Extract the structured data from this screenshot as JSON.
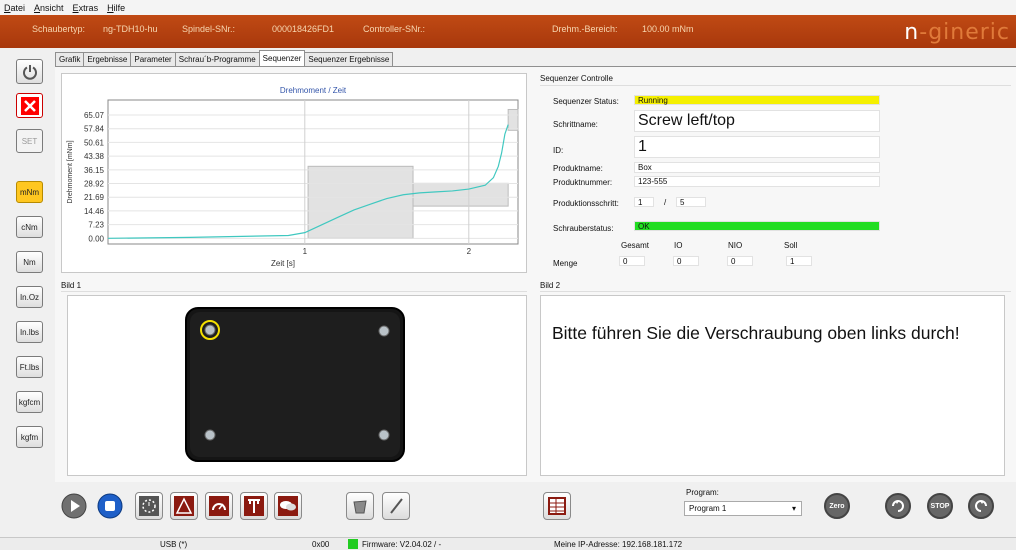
{
  "menu": {
    "items": [
      "Datei",
      "Ansicht",
      "Extras",
      "Hilfe"
    ]
  },
  "header": {
    "schraubertyp_label": "Schaubertyp:",
    "schraubertyp_value": "ng-TDH10-hu",
    "spindel_label": "Spindel-SNr.:",
    "spindel_value": "000018426FD1",
    "controller_label": "Controller-SNr.:",
    "controller_value": "",
    "range_label": "Drehm.-Bereich:",
    "range_value": "100.00 mNm",
    "brand_logo": "n-gineric"
  },
  "sidebar": {
    "power_icon": "power-icon",
    "close_icon": "close-icon",
    "set_label": "SET",
    "units": [
      "mNm",
      "cNm",
      "Nm",
      "In.Oz",
      "In.lbs",
      "Ft.lbs",
      "kgfcm",
      "kgfm"
    ],
    "active_unit": "mNm"
  },
  "tabs": [
    "Grafik",
    "Ergebnisse",
    "Parameter",
    "Schrau´b-Programme",
    "Sequenzer",
    "Sequenzer Ergebnisse"
  ],
  "selected_tab": "Sequenzer",
  "chart_panel": {
    "chart_data": {
      "type": "line",
      "title": "Drehmoment / Zeit",
      "xlabel": "Zeit [s]",
      "ylabel": "Drehmoment [mNm]",
      "yticks": [
        "65.07",
        "57.84",
        "50.61",
        "43.38",
        "36.15",
        "28.92",
        "21.69",
        "14.46",
        "7.23",
        "0.00"
      ],
      "xticks": [
        "1",
        "2"
      ],
      "xlim": [
        -0.2,
        2.3
      ],
      "ylim": [
        -3,
        73
      ],
      "grid": true,
      "series": [
        {
          "color": "#40c8c0",
          "x": [
            -0.2,
            0.3,
            0.9,
            1.0,
            1.1,
            1.2,
            1.3,
            1.4,
            1.5,
            1.6,
            1.7,
            1.8,
            1.9,
            2.0,
            2.1,
            2.15,
            2.18,
            2.2,
            2.22,
            2.24
          ],
          "y": [
            0,
            0.5,
            1.5,
            3,
            7,
            11,
            15,
            18,
            21,
            23,
            24,
            24.5,
            25,
            26,
            28,
            32,
            38,
            45,
            55,
            60
          ]
        }
      ],
      "regions": [
        {
          "x0": 1.02,
          "x1": 1.66,
          "y0": 0,
          "y1": 38
        },
        {
          "x0": 1.66,
          "x1": 2.24,
          "y0": 17,
          "y1": 29
        },
        {
          "x0": 2.24,
          "x1": 2.3,
          "y0": 57,
          "y1": 68
        }
      ]
    }
  },
  "sequencer": {
    "title": "Sequenzer Controlle",
    "status_label": "Sequenzer Status:",
    "status_value": "Running",
    "status_color": "#f5f000",
    "step_label": "Schrittname:",
    "step_value": "Screw left/top",
    "id_label": "ID:",
    "id_value": "1",
    "product_name_label": "Produktname:",
    "product_name_value": "Box",
    "product_number_label": "Produktnummer:",
    "product_number_value": "123-555",
    "production_step_label": "Produktionsschritt:",
    "production_step_current": "1",
    "production_step_sep": "/",
    "production_step_total": "5",
    "screwer_status_label": "Schrauberstatus:",
    "screwer_status_value": "OK",
    "screwer_status_color": "#22dd22",
    "col_headers": [
      "Gesamt",
      "IO",
      "NIO",
      "Soll"
    ],
    "menge_label": "Menge",
    "menge_values": [
      "0",
      "0",
      "0",
      "1"
    ]
  },
  "bild1": {
    "title": "Bild 1"
  },
  "bild2": {
    "title": "Bild 2",
    "instruction": "Bitte führen Sie die Verschraubung oben links durch!"
  },
  "program": {
    "label": "Program:",
    "selected": "Program 1"
  },
  "statusbar": {
    "usb": "USB (*)",
    "code": "0x00",
    "firmware": "Firmware: V2.04.02 / -",
    "firmware_color": "#22cc22",
    "ip": "Meine IP-Adresse: 192.168.181.172"
  }
}
